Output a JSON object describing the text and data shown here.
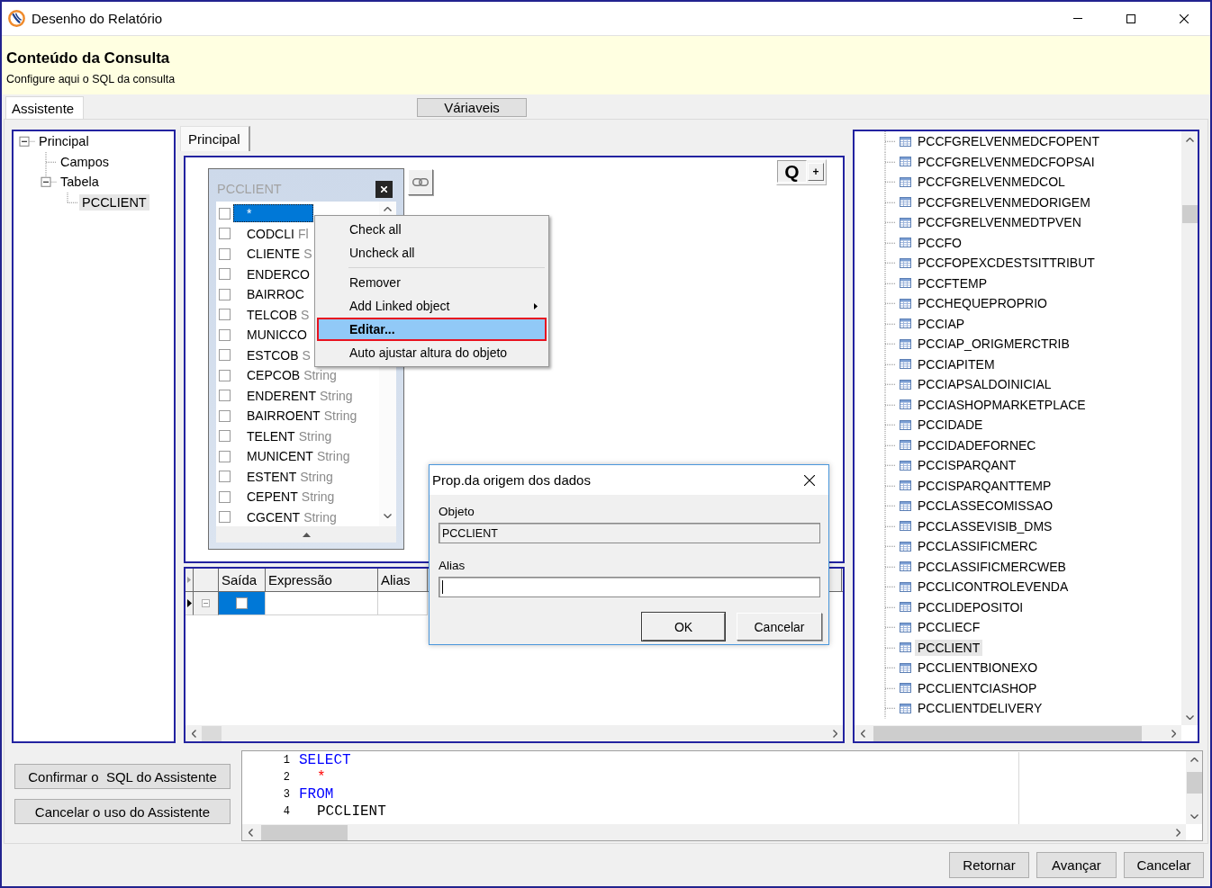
{
  "window": {
    "title": "Desenho do Relatório"
  },
  "header": {
    "title": "Conteúdo da Consulta",
    "subtitle": "Configure aqui o SQL da consulta"
  },
  "tabs": [
    {
      "label": "Assistente",
      "selected": true
    }
  ],
  "variables_button": {
    "label": "Váriaveis"
  },
  "tree": [
    {
      "label": "Principal",
      "expanded": true,
      "selected": false,
      "children": [
        {
          "label": "Campos",
          "selected": false
        },
        {
          "label": "Tabela",
          "expanded": true,
          "selected": false,
          "children": [
            {
              "label": "PCCLIENT",
              "selected": true
            }
          ]
        }
      ]
    }
  ],
  "designer": {
    "tabs": [
      {
        "label": "Principal",
        "selected": true
      }
    ],
    "zoom_buttons": [
      {
        "label": "Q",
        "kind": "toggle"
      },
      {
        "label": "+",
        "kind": "button"
      }
    ],
    "table_box": {
      "title": "PCCLIENT",
      "fields": [
        {
          "name": "*",
          "checked": false,
          "selected": true
        },
        {
          "name": "CODCLI",
          "type": "Fl",
          "checked": false,
          "selected": false
        },
        {
          "name": "CLIENTE",
          "type": "S",
          "checked": false,
          "selected": false
        },
        {
          "name": "ENDERCO",
          "checked": false,
          "selected": false
        },
        {
          "name": "BAIRROC",
          "checked": false,
          "selected": false
        },
        {
          "name": "TELCOB",
          "type": "S",
          "checked": false,
          "selected": false
        },
        {
          "name": "MUNICCO",
          "checked": false,
          "selected": false
        },
        {
          "name": "ESTCOB",
          "type": "S",
          "checked": false,
          "selected": false
        },
        {
          "name": "CEPCOB",
          "type": "String",
          "checked": false,
          "selected": false
        },
        {
          "name": "ENDERENT",
          "type": "String",
          "checked": false,
          "selected": false
        },
        {
          "name": "BAIRROENT",
          "type": "String",
          "checked": false,
          "selected": false
        },
        {
          "name": "TELENT",
          "type": "String",
          "checked": false,
          "selected": false
        },
        {
          "name": "MUNICENT",
          "type": "String",
          "checked": false,
          "selected": false
        },
        {
          "name": "ESTENT",
          "type": "String",
          "checked": false,
          "selected": false
        },
        {
          "name": "CEPENT",
          "type": "String",
          "checked": false,
          "selected": false
        },
        {
          "name": "CGCENT",
          "type": "String",
          "checked": false,
          "selected": false
        }
      ]
    }
  },
  "context_menu": {
    "items": [
      {
        "kind": "item",
        "label": "Check all",
        "selected": false,
        "outlined": false,
        "submenu": false
      },
      {
        "kind": "item",
        "label": "Uncheck all",
        "selected": false,
        "outlined": false,
        "submenu": false
      },
      {
        "kind": "separator"
      },
      {
        "kind": "item",
        "label": "Remover",
        "selected": false,
        "outlined": false,
        "submenu": false
      },
      {
        "kind": "item",
        "label": "Add Linked object",
        "selected": false,
        "outlined": false,
        "submenu": true
      },
      {
        "kind": "item",
        "label": "Editar...",
        "selected": true,
        "outlined": true,
        "submenu": false
      },
      {
        "kind": "item",
        "label": "Auto ajustar altura do objeto",
        "selected": false,
        "outlined": false,
        "submenu": false
      }
    ]
  },
  "dialog": {
    "title": "Prop.da origem dos dados",
    "fields": [
      {
        "label": "Objeto",
        "value": "PCCLIENT",
        "readonly": true,
        "focused": false
      },
      {
        "label": "Alias",
        "readonly": false,
        "focused": true
      }
    ],
    "buttons": [
      {
        "label": "OK",
        "default": true
      },
      {
        "label": "Cancelar",
        "default": false
      }
    ]
  },
  "grid": {
    "columns": [
      "Saída",
      "Expressão",
      "Alias"
    ],
    "rows": [
      {
        "selected": true,
        "output": false
      }
    ]
  },
  "table_list": {
    "items": [
      {
        "label": "PCCFGRELVENMEDCFOPENT",
        "selected": false
      },
      {
        "label": "PCCFGRELVENMEDCFOPSAI",
        "selected": false
      },
      {
        "label": "PCCFGRELVENMEDCOL",
        "selected": false
      },
      {
        "label": "PCCFGRELVENMEDORIGEM",
        "selected": false
      },
      {
        "label": "PCCFGRELVENMEDTPVEN",
        "selected": false
      },
      {
        "label": "PCCFO",
        "selected": false
      },
      {
        "label": "PCCFOPEXCDESTSITTRIBUT",
        "selected": false
      },
      {
        "label": "PCCFTEMP",
        "selected": false
      },
      {
        "label": "PCCHEQUEPROPRIO",
        "selected": false
      },
      {
        "label": "PCCIAP",
        "selected": false
      },
      {
        "label": "PCCIAP_ORIGMERCTRIB",
        "selected": false
      },
      {
        "label": "PCCIAPITEM",
        "selected": false
      },
      {
        "label": "PCCIAPSALDOINICIAL",
        "selected": false
      },
      {
        "label": "PCCIASHOPMARKETPLACE",
        "selected": false
      },
      {
        "label": "PCCIDADE",
        "selected": false
      },
      {
        "label": "PCCIDADEFORNEC",
        "selected": false
      },
      {
        "label": "PCCISPARQANT",
        "selected": false
      },
      {
        "label": "PCCISPARQANTTEMP",
        "selected": false
      },
      {
        "label": "PCCLASSECOMISSAO",
        "selected": false
      },
      {
        "label": "PCCLASSEVISIB_DMS",
        "selected": false
      },
      {
        "label": "PCCLASSIFICMERC",
        "selected": false
      },
      {
        "label": "PCCLASSIFICMERCWEB",
        "selected": false
      },
      {
        "label": "PCCLICONTROLEVENDA",
        "selected": false
      },
      {
        "label": "PCCLIDEPOSITOI",
        "selected": false
      },
      {
        "label": "PCCLIECF",
        "selected": false
      },
      {
        "label": "PCCLIENT",
        "selected": true
      },
      {
        "label": "PCCLIENTBIONEXO",
        "selected": false
      },
      {
        "label": "PCCLIENTCIASHOP",
        "selected": false
      },
      {
        "label": "PCCLIENTDELIVERY",
        "selected": false
      }
    ]
  },
  "assistant_buttons": [
    "Confirmar o  SQL do Assistente",
    "Cancelar o uso do Assistente"
  ],
  "sql": {
    "lines": [
      {
        "number": "1",
        "tokens": [
          {
            "kind": "keyword",
            "text": "SELECT"
          }
        ],
        "children": [
          {
            "number": "2",
            "tokens": [
              {
                "kind": "operator",
                "text": "*"
              }
            ]
          }
        ]
      },
      {
        "number": "3",
        "tokens": [
          {
            "kind": "keyword",
            "text": "FROM"
          }
        ],
        "children": [
          {
            "number": "4",
            "tokens": [
              {
                "kind": "identifier",
                "text": "PCCLIENT"
              }
            ]
          }
        ]
      }
    ]
  },
  "footer_buttons": [
    "Retornar",
    "Avançar",
    "Cancelar"
  ]
}
